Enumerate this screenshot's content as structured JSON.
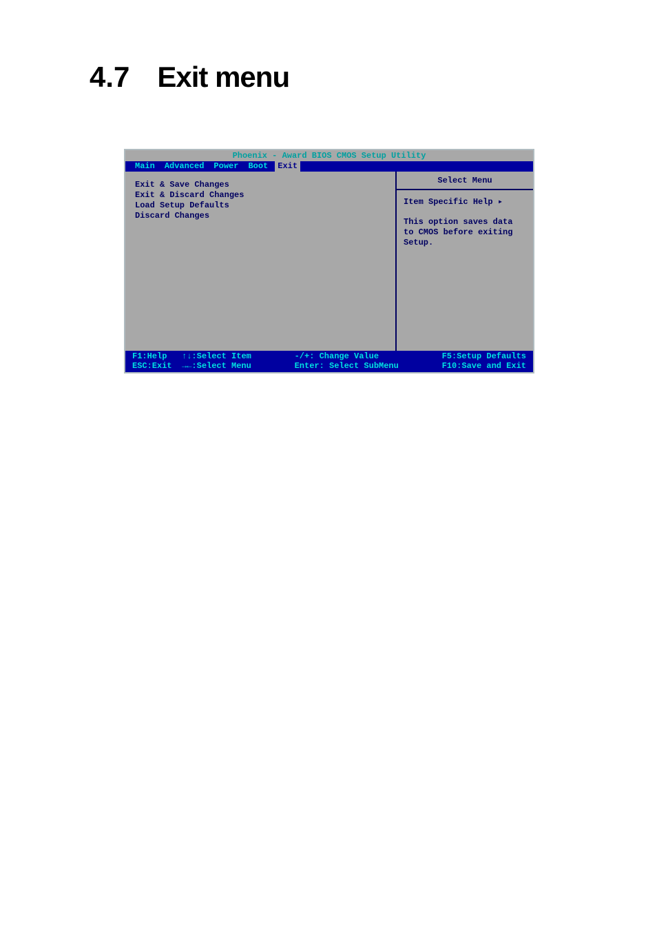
{
  "heading": {
    "number": "4.7",
    "title": "Exit menu"
  },
  "bios": {
    "title": "Phoenix - Award BIOS CMOS Setup Utility",
    "menubar": [
      "Main",
      "Advanced",
      "Power",
      "Boot",
      "Exit"
    ],
    "active_tab": "Exit",
    "items": [
      "Exit & Save Changes",
      "Exit & Discard Changes",
      "Load Setup Defaults",
      "Discard Changes"
    ],
    "help": {
      "title": "Select Menu",
      "subtitle": "Item Specific Help ▸",
      "body": "This option saves data to CMOS before exiting Setup."
    },
    "footer": {
      "left1": "F1:Help",
      "left2": "ESC:Exit",
      "mid1": "↑↓:Select Item",
      "mid2": "→←:Select Menu",
      "center1": "-/+: Change Value",
      "center2": "Enter: Select SubMenu",
      "right1": "F5:Setup Defaults",
      "right2": "F10:Save and Exit"
    }
  }
}
